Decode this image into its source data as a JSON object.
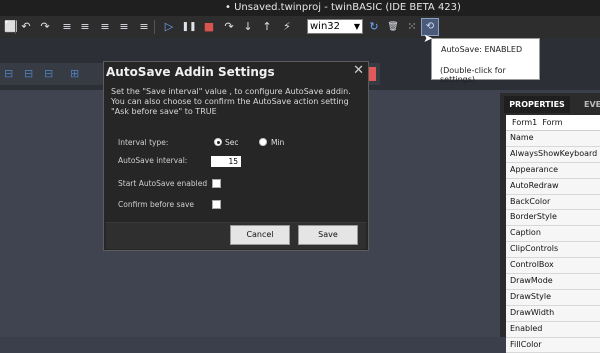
{
  "titlebar": {
    "title": "• Unsaved.twinproj - twinBASIC (IDE BETA 423)"
  },
  "toolbar": {
    "target_select": "win32",
    "icons": {
      "bookmark": "⬜",
      "undo": "↶",
      "redo": "↷",
      "align_left": "≡",
      "indent": "≡",
      "outdent": "≡",
      "comment": "≡",
      "play": "▷",
      "pause": "❚❚",
      "stop": "■",
      "step_over": "↷",
      "step_into": "↓",
      "step_out": "↑",
      "run_cursor": "⚡",
      "refresh": "↻",
      "delete": "🗑",
      "grid": "⁙",
      "autosave": "⟲"
    }
  },
  "tooltip": {
    "line1": "AutoSave: ENABLED",
    "line2": "(Double-click for settings)"
  },
  "dialog": {
    "title": "AutoSave Addin Settings",
    "close": "✕",
    "description": "Set the \"Save interval\" value , to configure AutoSave addin. You can also choose to confirm the AutoSave action setting \"Ask before save\" to TRUE",
    "interval_type_label": "Interval type:",
    "interval_sec": "Sec",
    "interval_min": "Min",
    "autosave_interval_label": "AutoSave interval:",
    "autosave_interval_value": "15",
    "start_enabled_label": "Start AutoSave enabled",
    "confirm_label": "Confirm before save",
    "cancel": "Cancel",
    "save": "Save"
  },
  "properties": {
    "tab": "PROPERTIES",
    "tab_next": "EVE",
    "object": "Form1",
    "object_type": "Form",
    "rows": [
      "Name",
      "AlwaysShowKeyboard",
      "Appearance",
      "AutoRedraw",
      "BackColor",
      "BorderStyle",
      "Caption",
      "ClipControls",
      "ControlBox",
      "DrawMode",
      "DrawStyle",
      "DrawWidth",
      "Enabled",
      "FillColor"
    ]
  },
  "colors": {
    "accent": "#4e7fb8",
    "dialog_bg": "#262626",
    "canvas": "#3f4450"
  }
}
